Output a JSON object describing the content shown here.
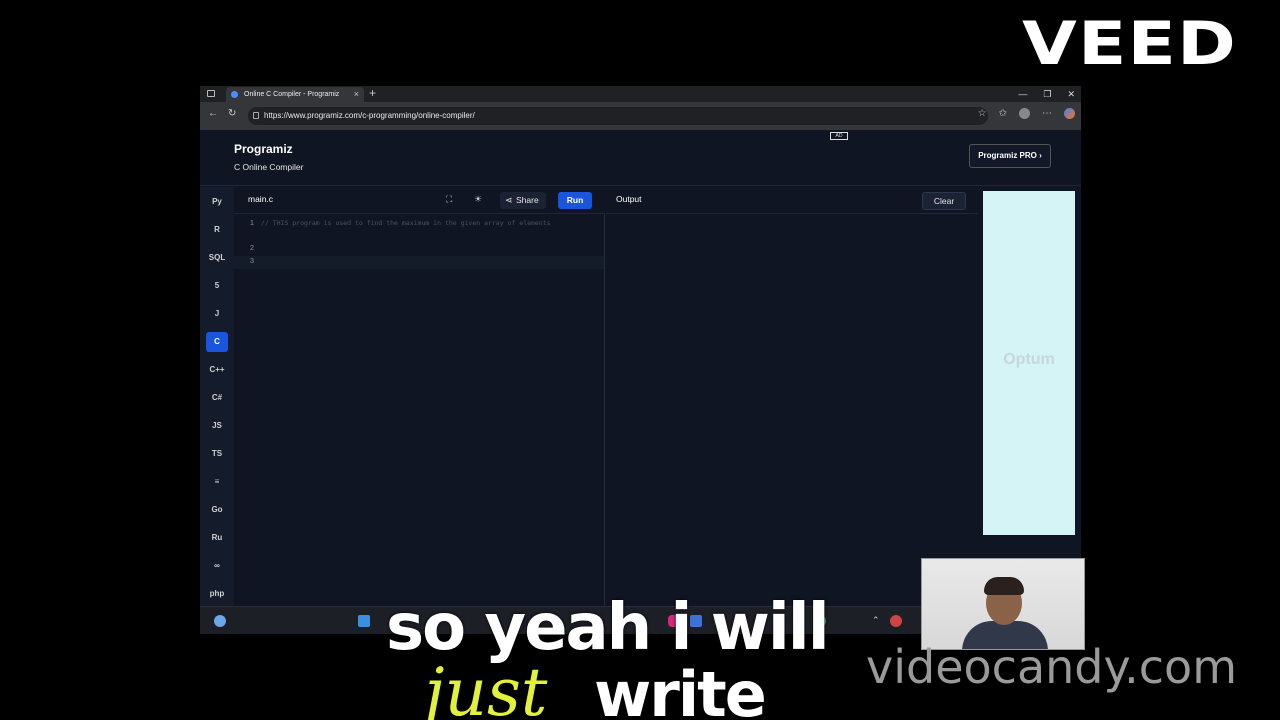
{
  "watermark": {
    "logo": "VEED",
    "site": "videocandy.com"
  },
  "browser": {
    "tab_title": "Online C Compiler - Programiz",
    "url": "https://www.programiz.com/c-programming/online-compiler/"
  },
  "site": {
    "brand": "Programiz",
    "subtitle": "C Online Compiler",
    "pro_button": "Programiz PRO ›",
    "ad_badge": "AD"
  },
  "languages": [
    {
      "label": "Py",
      "icon": "python-icon"
    },
    {
      "label": "R",
      "icon": "r-icon"
    },
    {
      "label": "SQL",
      "icon": "sql-icon"
    },
    {
      "label": "5",
      "icon": "html-icon"
    },
    {
      "label": "J",
      "icon": "java-icon"
    },
    {
      "label": "C",
      "icon": "c-icon"
    },
    {
      "label": "C++",
      "icon": "cpp-icon"
    },
    {
      "label": "C#",
      "icon": "csharp-icon"
    },
    {
      "label": "JS",
      "icon": "javascript-icon"
    },
    {
      "label": "TS",
      "icon": "typescript-icon"
    },
    {
      "label": "≡",
      "icon": "stack-icon"
    },
    {
      "label": "Go",
      "icon": "go-icon"
    },
    {
      "label": "Ru",
      "icon": "rust-icon"
    },
    {
      "label": "∞",
      "icon": "kotlin-icon"
    },
    {
      "label": "php",
      "icon": "php-icon"
    }
  ],
  "editor": {
    "file_name": "main.c",
    "share_label": "Share",
    "run_label": "Run",
    "line_numbers": [
      "1",
      "",
      "2",
      "3"
    ],
    "comment": "// THIS program is used to find the maximum in the given array of elements"
  },
  "output": {
    "label": "Output",
    "clear_label": "Clear"
  },
  "ad": {
    "brand": "Optum"
  },
  "captions": {
    "line1": "so yeah i will",
    "word_italic": "just",
    "word_plain": "write"
  },
  "colors": {
    "accent": "#1a56db",
    "caption_highlight": "#e2f23a"
  }
}
